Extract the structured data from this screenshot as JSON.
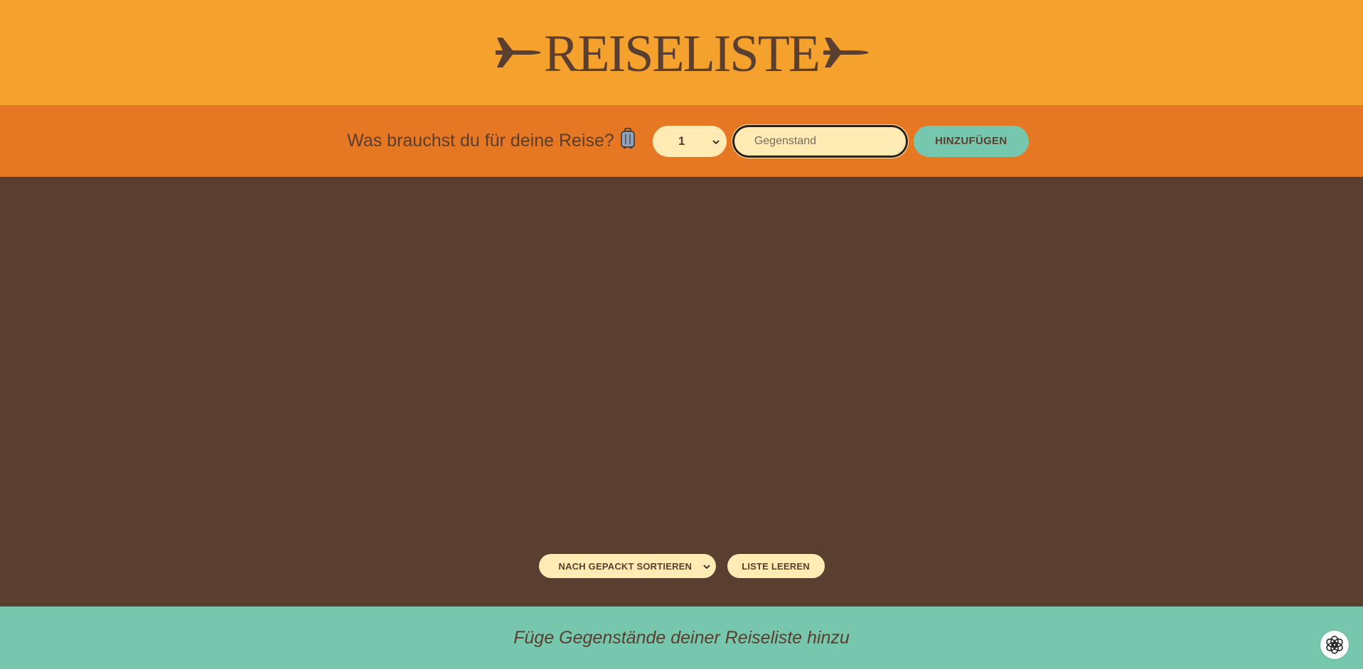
{
  "header": {
    "title": "REISELISTE",
    "left_icon": "airplane-icon",
    "right_icon": "airplane-icon"
  },
  "form": {
    "question": "Was brauchst du für deine Reise?",
    "question_icon": "suitcase-icon",
    "quantity_selected": "1",
    "item_placeholder": "Gegenstand",
    "add_label": "HINZUFÜGEN"
  },
  "actions": {
    "sort_selected": "NACH GEPACKT SORTIEREN",
    "clear_label": "LISTE LEEREN"
  },
  "footer": {
    "message": "Füge Gegenstände deiner Reiseliste hinzu"
  },
  "colors": {
    "header_bg": "#f4a22d",
    "form_bg": "#e67723",
    "main_bg": "#5a3e2f",
    "footer_bg": "#76c7ad",
    "input_bg": "#ffebb3",
    "text": "#5a3e2f"
  }
}
